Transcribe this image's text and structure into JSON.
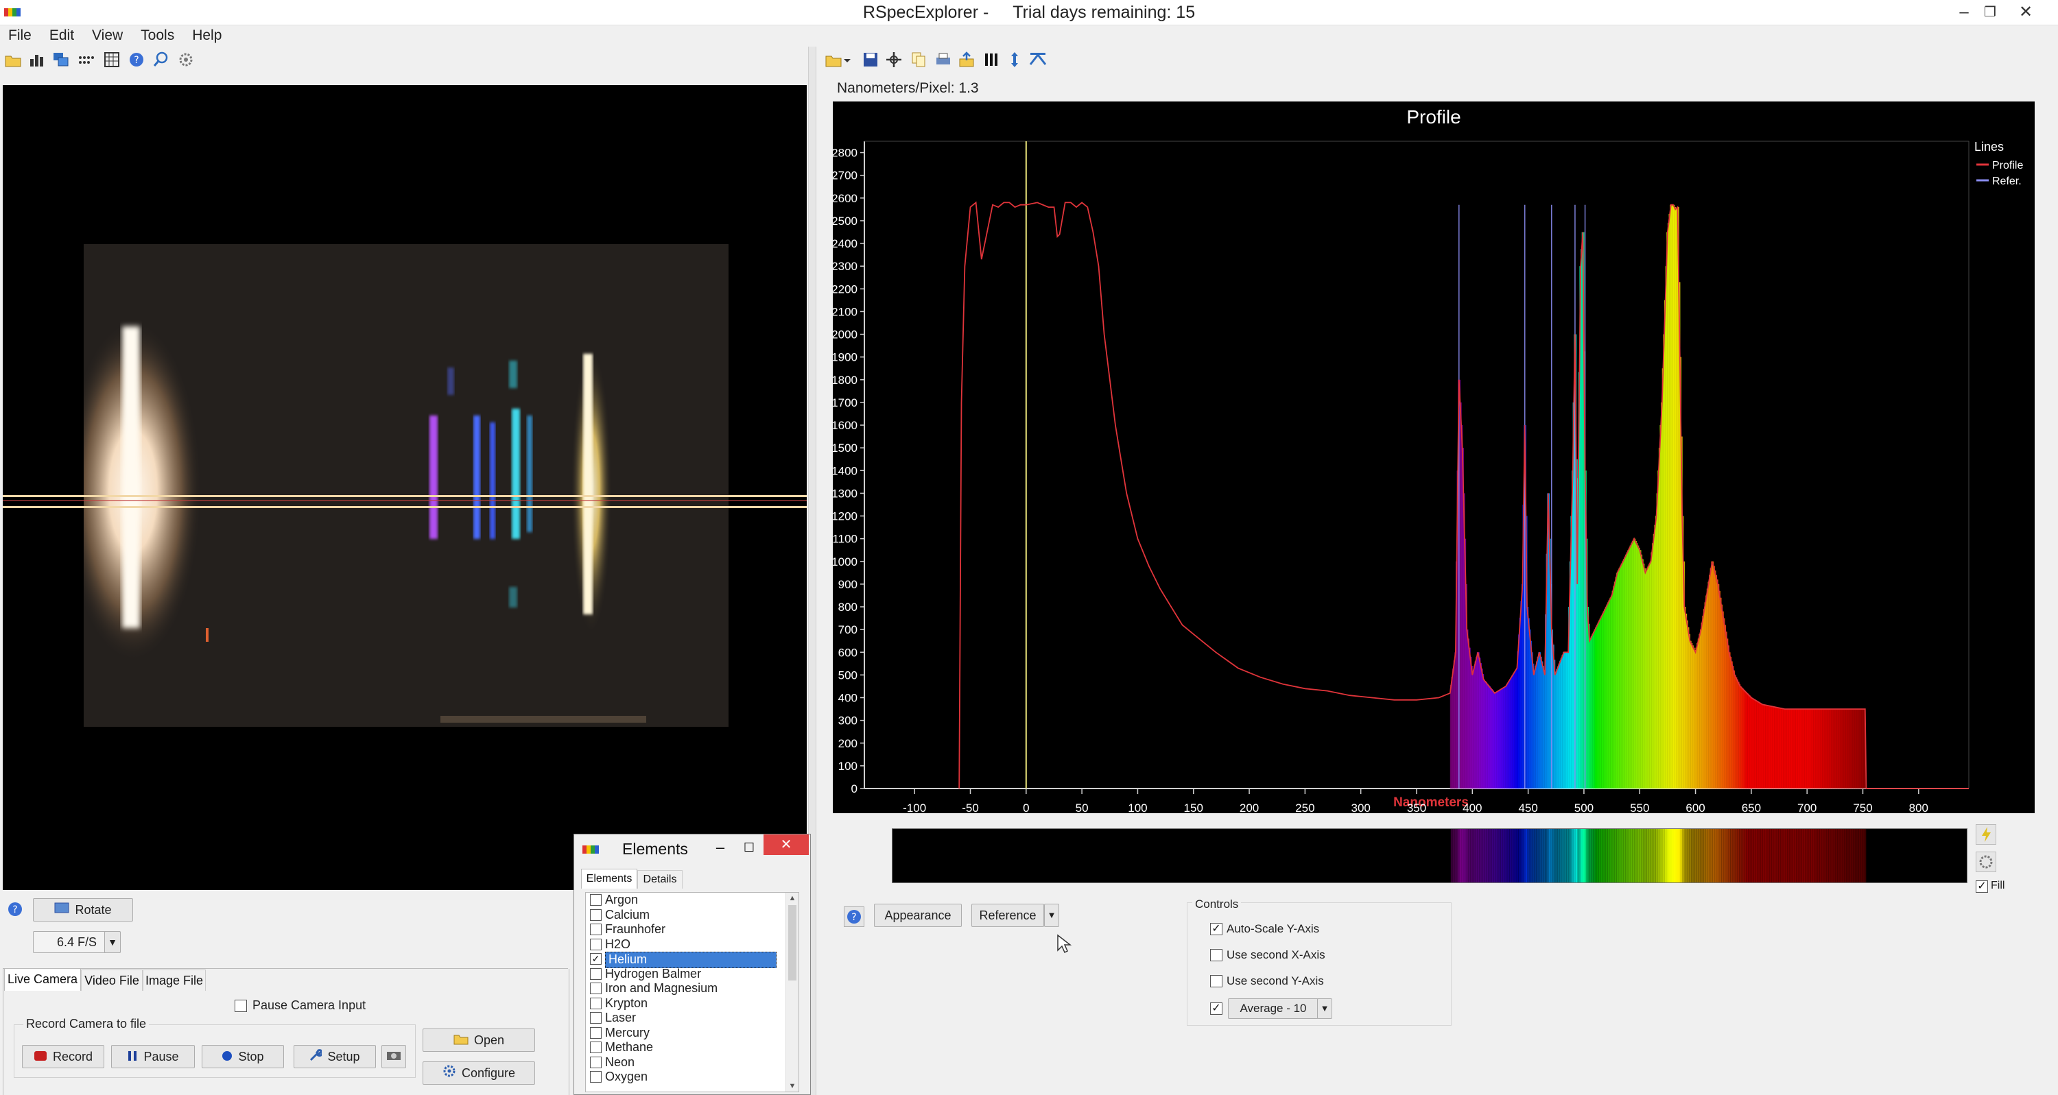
{
  "app": {
    "title": "RSpecExplorer -",
    "trial": "Trial days remaining: 15"
  },
  "menu": [
    "File",
    "Edit",
    "View",
    "Tools",
    "Help"
  ],
  "camera": {
    "rotate_label": "Rotate",
    "fps_value": "6.4 F/S",
    "tabs": [
      "Live Camera",
      "Video File",
      "Image File"
    ],
    "pause_input_label": "Pause Camera Input",
    "record_group_label": "Record Camera to file",
    "record_label": "Record",
    "pause_label": "Pause",
    "stop_label": "Stop",
    "setup_label": "Setup",
    "open_label": "Open",
    "configure_label": "Configure"
  },
  "profile": {
    "nm_per_pixel": "Nanometers/Pixel: 1.3",
    "appearance_label": "Appearance",
    "reference_label": "Reference",
    "fill_label": "Fill",
    "fill_checked": true
  },
  "controls": {
    "group_label": "Controls",
    "autoscale_label": "Auto-Scale Y-Axis",
    "autoscale_checked": true,
    "second_x_label": "Use second X-Axis",
    "second_x_checked": false,
    "second_y_label": "Use second Y-Axis",
    "second_y_checked": false,
    "average_value": "Average - 10",
    "average_checked": true
  },
  "elements_window": {
    "title": "Elements",
    "tabs": [
      "Elements",
      "Details"
    ],
    "items": [
      {
        "label": "Argon",
        "checked": false
      },
      {
        "label": "Calcium",
        "checked": false
      },
      {
        "label": "Fraunhofer",
        "checked": false
      },
      {
        "label": "H2O",
        "checked": false
      },
      {
        "label": "Helium",
        "checked": true
      },
      {
        "label": "Hydrogen Balmer",
        "checked": false
      },
      {
        "label": "Iron and Magnesium",
        "checked": false
      },
      {
        "label": "Krypton",
        "checked": false
      },
      {
        "label": "Laser",
        "checked": false
      },
      {
        "label": "Mercury",
        "checked": false
      },
      {
        "label": "Methane",
        "checked": false
      },
      {
        "label": "Neon",
        "checked": false
      },
      {
        "label": "Oxygen",
        "checked": false
      }
    ]
  },
  "colors": {
    "profile_line": "#e0343a",
    "reference_line": "#8a8cf0",
    "marker_line": "#e8e27a",
    "selection": "#3d7fd6"
  },
  "chart_data": {
    "type": "line",
    "title": "Profile",
    "xlabel": "Nanometers",
    "ylabel": "",
    "xlim": [
      -145,
      845
    ],
    "ylim": [
      0,
      2850
    ],
    "x_ticks": [
      -100,
      -50,
      0,
      50,
      100,
      150,
      200,
      250,
      300,
      350,
      400,
      450,
      500,
      550,
      600,
      650,
      700,
      750,
      800
    ],
    "y_ticks": [
      0,
      100,
      200,
      300,
      400,
      500,
      600,
      700,
      800,
      900,
      1000,
      1100,
      1200,
      1300,
      1400,
      1500,
      1600,
      1700,
      1800,
      1900,
      2000,
      2100,
      2200,
      2300,
      2400,
      2500,
      2600,
      2700,
      2800
    ],
    "legend": {
      "title": "Lines",
      "placement": "top-right",
      "entries": [
        "Profile",
        "Refer."
      ]
    },
    "marker_x": 0,
    "reference_lines_x": [
      388,
      447,
      471,
      492,
      501
    ],
    "series": [
      {
        "name": "Profile",
        "x": [
          -60,
          -58,
          -55,
          -50,
          -45,
          -40,
          -35,
          -30,
          -25,
          -20,
          -15,
          -10,
          -5,
          0,
          10,
          20,
          25,
          28,
          30,
          35,
          40,
          45,
          50,
          55,
          60,
          65,
          70,
          75,
          80,
          85,
          90,
          95,
          100,
          110,
          120,
          130,
          140,
          150,
          170,
          190,
          210,
          230,
          250,
          270,
          290,
          310,
          330,
          350,
          370,
          380,
          385,
          388,
          391,
          395,
          400,
          405,
          410,
          420,
          430,
          440,
          445,
          447,
          449,
          455,
          460,
          465,
          468,
          471,
          474,
          478,
          482,
          486,
          490,
          492,
          494,
          497,
          499,
          501,
          503,
          505,
          510,
          515,
          520,
          525,
          530,
          535,
          540,
          545,
          550,
          555,
          560,
          565,
          570,
          575,
          578,
          580,
          582,
          584,
          586,
          588,
          590,
          595,
          600,
          605,
          610,
          615,
          620,
          625,
          630,
          635,
          640,
          650,
          660,
          670,
          680,
          690,
          700,
          720,
          740,
          752,
          753,
          760,
          845
        ],
        "y": [
          0,
          1700,
          2300,
          2560,
          2580,
          2330,
          2450,
          2570,
          2560,
          2580,
          2580,
          2560,
          2570,
          2570,
          2580,
          2560,
          2560,
          2430,
          2440,
          2580,
          2580,
          2560,
          2580,
          2560,
          2450,
          2300,
          2000,
          1800,
          1600,
          1450,
          1300,
          1200,
          1100,
          980,
          880,
          800,
          720,
          680,
          600,
          530,
          490,
          460,
          440,
          430,
          410,
          400,
          390,
          390,
          400,
          420,
          600,
          1800,
          1500,
          700,
          500,
          600,
          480,
          420,
          450,
          530,
          900,
          1600,
          800,
          500,
          600,
          500,
          1300,
          700,
          500,
          550,
          600,
          600,
          1400,
          2000,
          900,
          2300,
          2450,
          1400,
          800,
          650,
          700,
          750,
          800,
          850,
          950,
          1000,
          1050,
          1100,
          1050,
          950,
          1000,
          1200,
          1700,
          2450,
          2570,
          2570,
          2550,
          2560,
          1900,
          1200,
          800,
          650,
          600,
          700,
          850,
          1000,
          900,
          750,
          600,
          500,
          450,
          400,
          370,
          360,
          350,
          350,
          350,
          350,
          350,
          350,
          0,
          0,
          0
        ]
      }
    ]
  }
}
